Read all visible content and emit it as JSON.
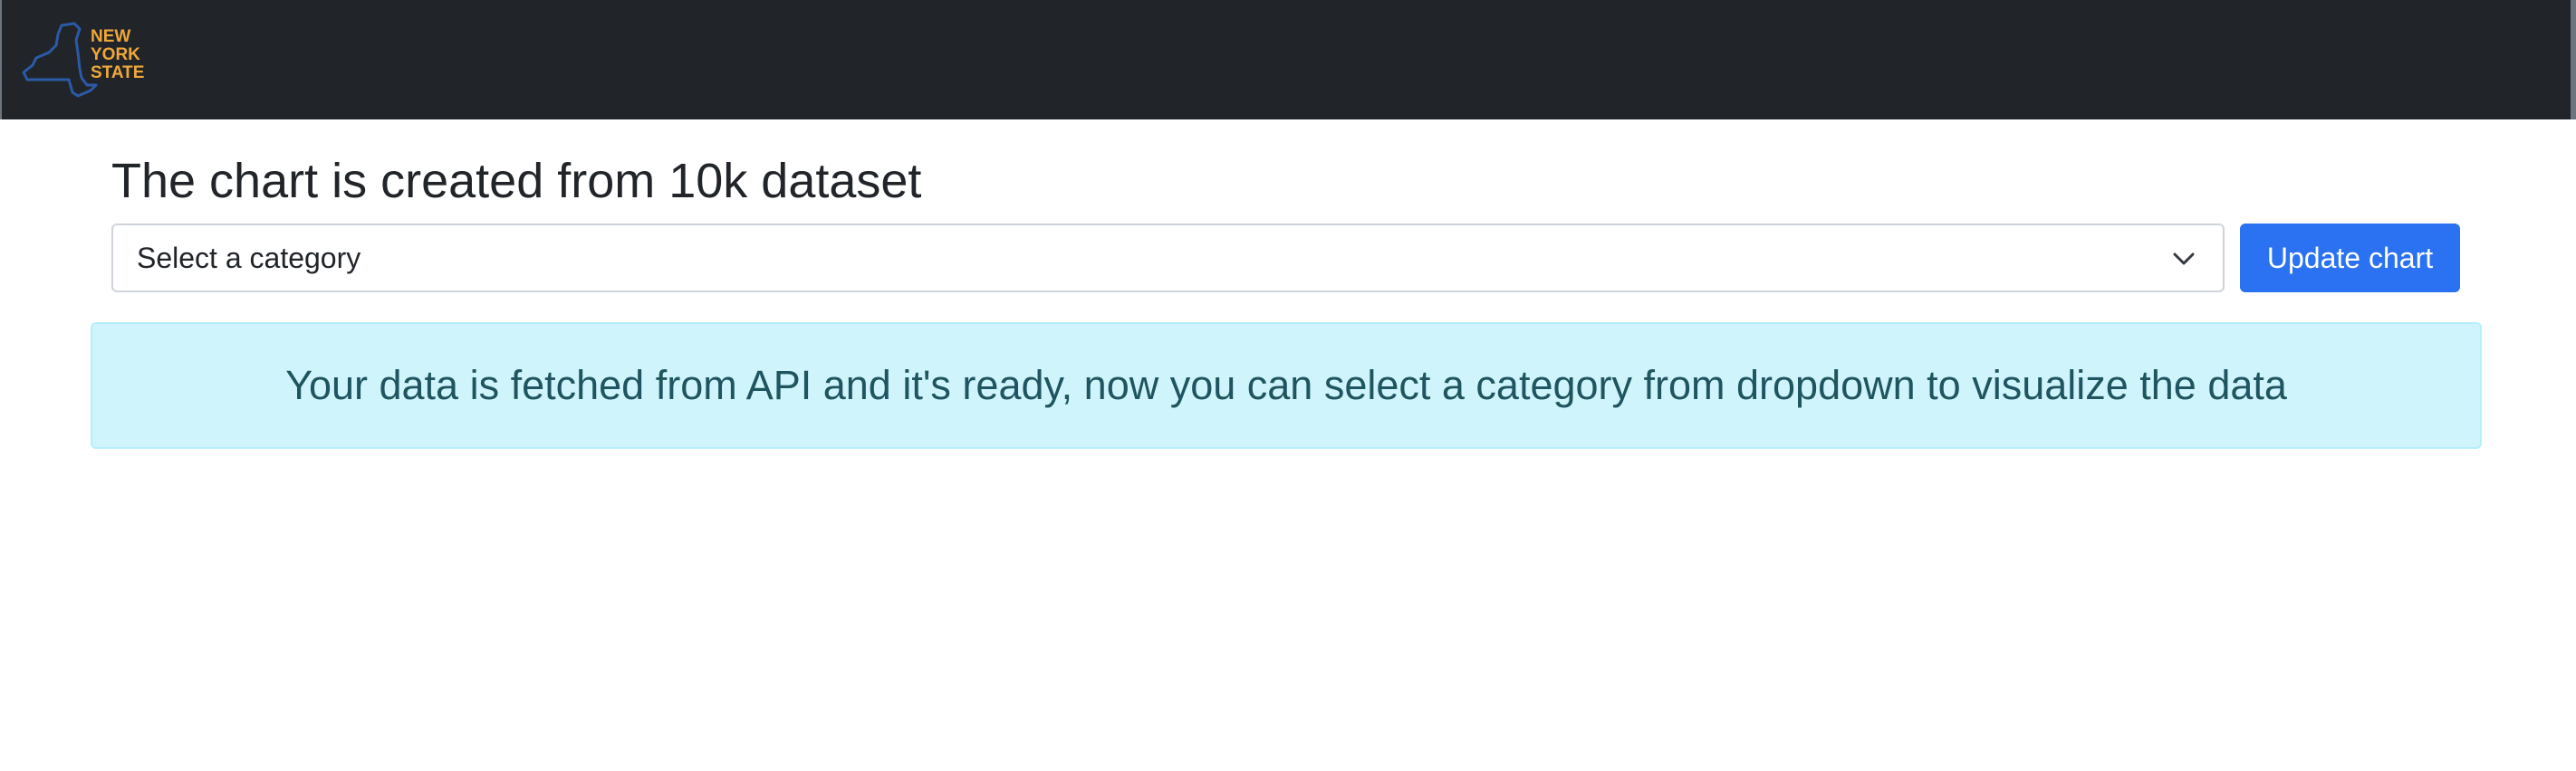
{
  "navbar": {
    "logo": {
      "icon": "new-york-state-map-logo",
      "text_lines": [
        "NEW",
        "YORK",
        "STATE"
      ],
      "outline_color": "#2a5aa8",
      "text_color": "#f0a73a"
    },
    "background_color": "#212529"
  },
  "main": {
    "title": "The chart is created from 10k dataset",
    "category_select": {
      "selected": "Select a category",
      "icon": "chevron-down-icon"
    },
    "update_button": {
      "label": "Update chart",
      "color": "#2a72f2"
    },
    "alert": {
      "message": "Your data is fetched from API and it's ready, now you can select a category from dropdown to visualize the data",
      "background_color": "#cff4fc",
      "text_color": "#1f5560"
    }
  }
}
